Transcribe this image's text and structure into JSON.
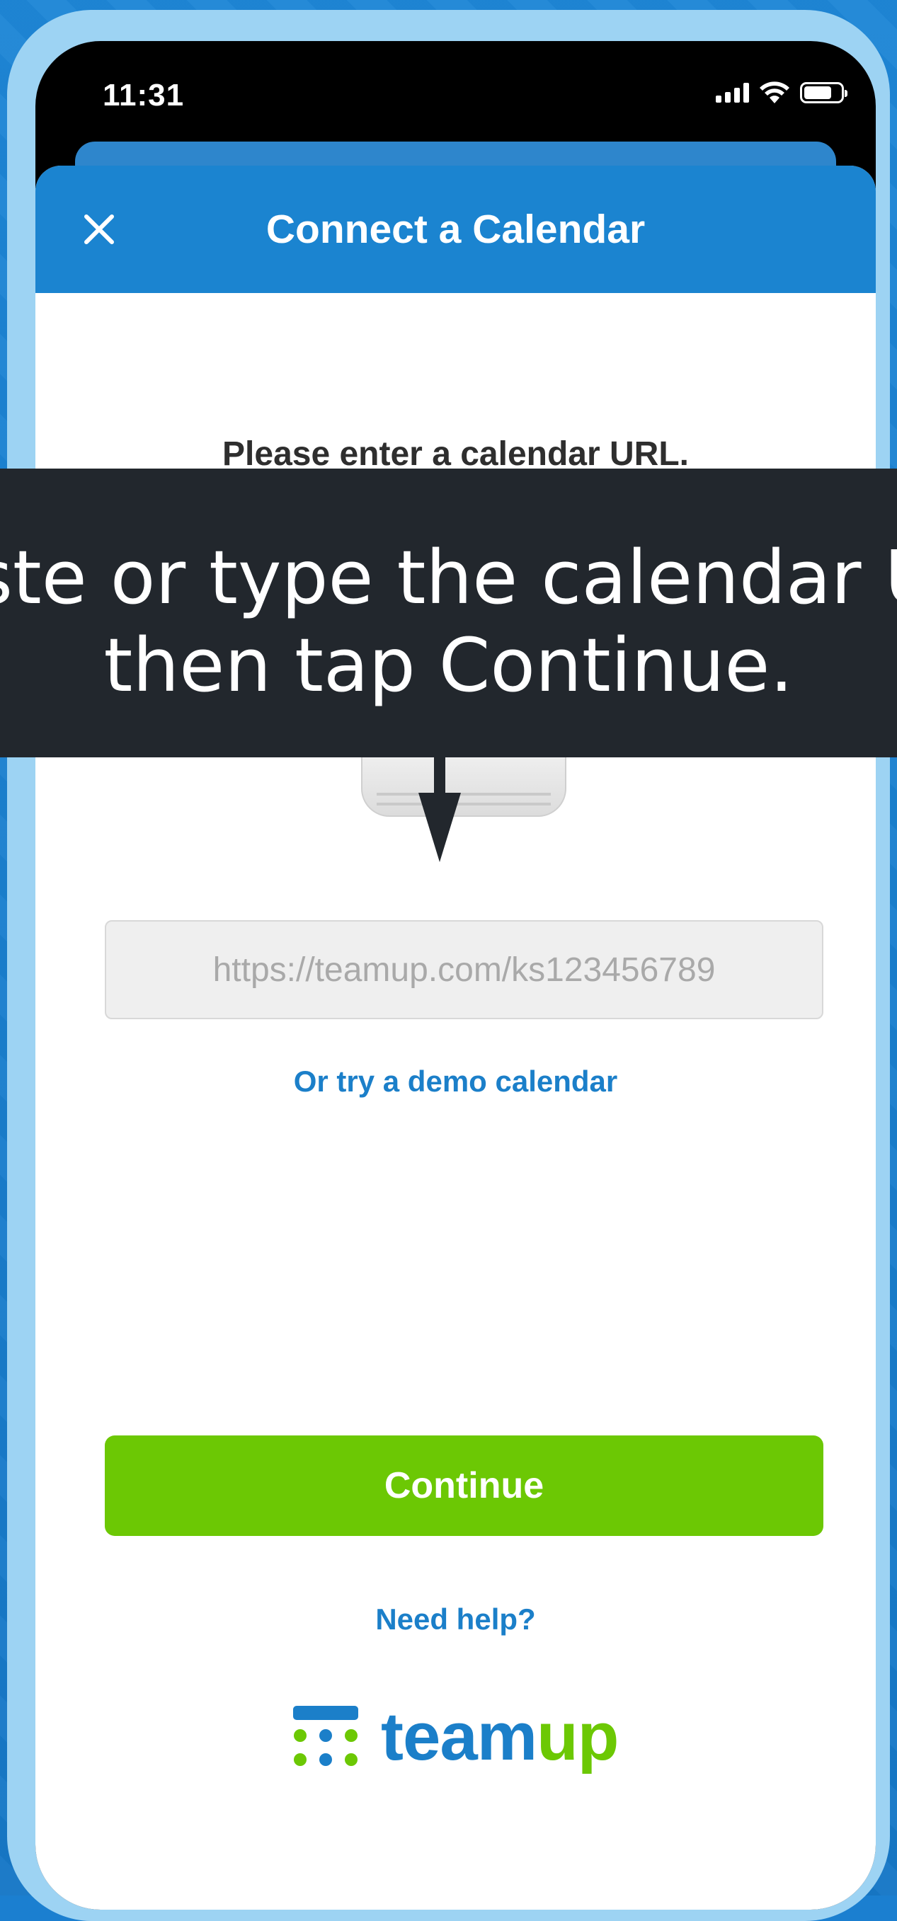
{
  "status_bar": {
    "time": "11:31"
  },
  "header": {
    "title": "Connect a Calendar"
  },
  "main": {
    "prompt": "Please enter a calendar URL.",
    "url_input": {
      "placeholder": "https://teamup.com/ks123456789",
      "value": ""
    },
    "demo_link": "Or try a demo calendar",
    "continue_label": "Continue",
    "help_link": "Need help?"
  },
  "logo": {
    "text_team": "team",
    "text_up": "up"
  },
  "tooltip": {
    "line1": "aste or type the calendar UR",
    "line2": "then tap Continue."
  },
  "colors": {
    "header_blue": "#1b84d0",
    "continue_green": "#6cc804",
    "link_blue": "#1b7fc9",
    "tooltip_bg": "#22272d"
  }
}
